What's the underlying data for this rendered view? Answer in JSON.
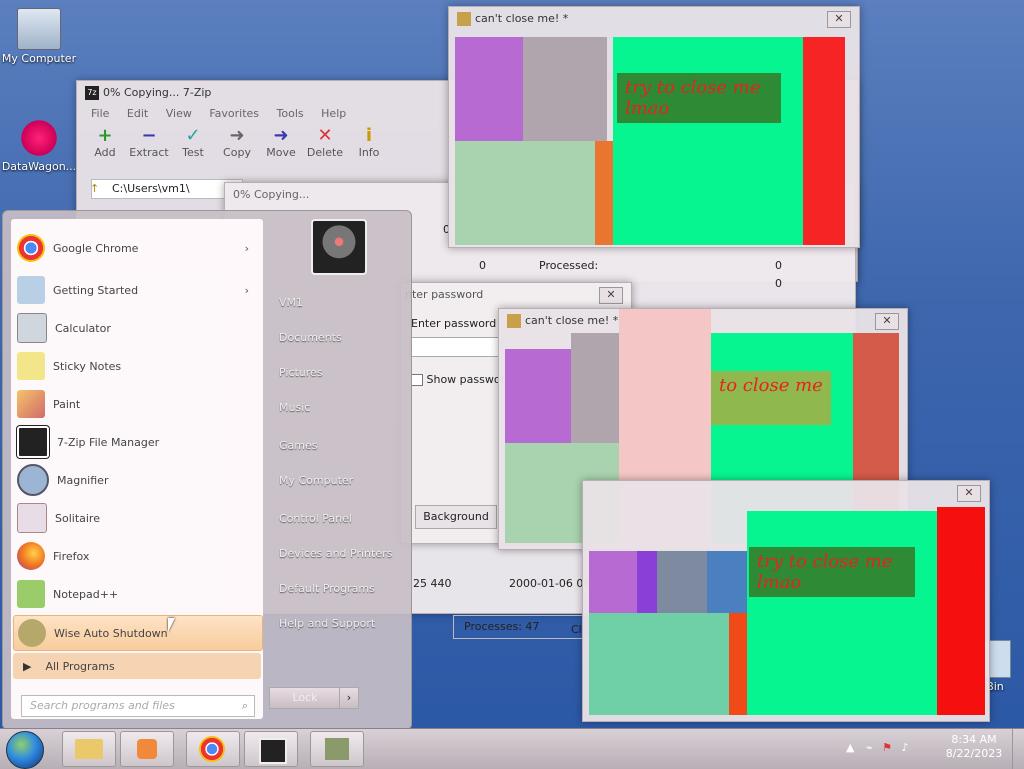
{
  "desktop": {
    "icons": [
      {
        "label": "My Computer",
        "icon": "computer-icon"
      },
      {
        "label": "DataWagon...",
        "icon": "datawagon-icon"
      },
      {
        "label": "Bin",
        "icon": "recycle-bin-icon"
      }
    ]
  },
  "sevenzip": {
    "title": "0% Copying... 7-Zip",
    "menu": [
      "File",
      "Edit",
      "View",
      "Favorites",
      "Tools",
      "Help"
    ],
    "toolbar": [
      {
        "label": "Add",
        "icon": "plus-icon",
        "color": "#2a9a2a"
      },
      {
        "label": "Extract",
        "icon": "minus-icon",
        "color": "#3a3ab0"
      },
      {
        "label": "Test",
        "icon": "check-icon",
        "color": "#2aa0a0"
      },
      {
        "label": "Copy",
        "icon": "copy-arrow-icon",
        "color": "#666"
      },
      {
        "label": "Move",
        "icon": "move-arrow-icon",
        "color": "#3a3ab0"
      },
      {
        "label": "Delete",
        "icon": "x-icon",
        "color": "#d33"
      },
      {
        "label": "Info",
        "icon": "info-icon",
        "color": "#c90"
      }
    ],
    "path": "C:\\Users\\vm1\\"
  },
  "copying": {
    "title": "0% Copying...",
    "row1_left": "0",
    "row2_left": "0",
    "processed_label": "Processed:",
    "processed_value": "0",
    "row3_value": "0",
    "size": "25 440",
    "date": "2000-01-06 06",
    "processes": "Processes: 47",
    "processes_tail": "Cl"
  },
  "password": {
    "title": "nter password",
    "label": "Enter password",
    "show": "Show password",
    "background_btn": "Background"
  },
  "troll_windows": [
    {
      "title": "can't close me! *",
      "text": "try to close me\nlmao"
    },
    {
      "title": "can't close me! *",
      "text": "to close me"
    },
    {
      "title": "",
      "text": "try to close me\nlmao"
    }
  ],
  "start_menu": {
    "programs": [
      {
        "label": "Google Chrome",
        "icon": "chrome-icon",
        "submenu": true
      },
      {
        "label": "Getting Started",
        "icon": "getting-started-icon",
        "submenu": true
      },
      {
        "label": "Calculator",
        "icon": "calculator-icon",
        "submenu": false
      },
      {
        "label": "Sticky Notes",
        "icon": "sticky-notes-icon",
        "submenu": false
      },
      {
        "label": "Paint",
        "icon": "paint-icon",
        "submenu": false
      },
      {
        "label": "7-Zip File Manager",
        "icon": "7zip-icon",
        "submenu": false
      },
      {
        "label": "Magnifier",
        "icon": "magnifier-icon",
        "submenu": false
      },
      {
        "label": "Solitaire",
        "icon": "solitaire-icon",
        "submenu": false
      },
      {
        "label": "Firefox",
        "icon": "firefox-icon",
        "submenu": false
      },
      {
        "label": "Notepad++",
        "icon": "notepadpp-icon",
        "submenu": false
      },
      {
        "label": "Wise Auto Shutdown",
        "icon": "wise-shutdown-icon",
        "submenu": false,
        "highlighted": true
      }
    ],
    "all_programs": "All Programs",
    "search_placeholder": "Search programs and files",
    "right_items": [
      "VM1",
      "Documents",
      "Pictures",
      "Music",
      "Games",
      "My Computer",
      "Control Panel",
      "Devices and Printers",
      "Default Programs",
      "Help and Support"
    ],
    "lock_label": "Lock"
  },
  "taskbar": {
    "apps": [
      {
        "icon": "explorer-icon"
      },
      {
        "icon": "media-player-icon"
      },
      {
        "icon": "chrome-icon"
      },
      {
        "icon": "7zip-icon"
      },
      {
        "icon": "wise-icon"
      }
    ],
    "time": "8:34 AM",
    "date": "8/22/2023"
  }
}
